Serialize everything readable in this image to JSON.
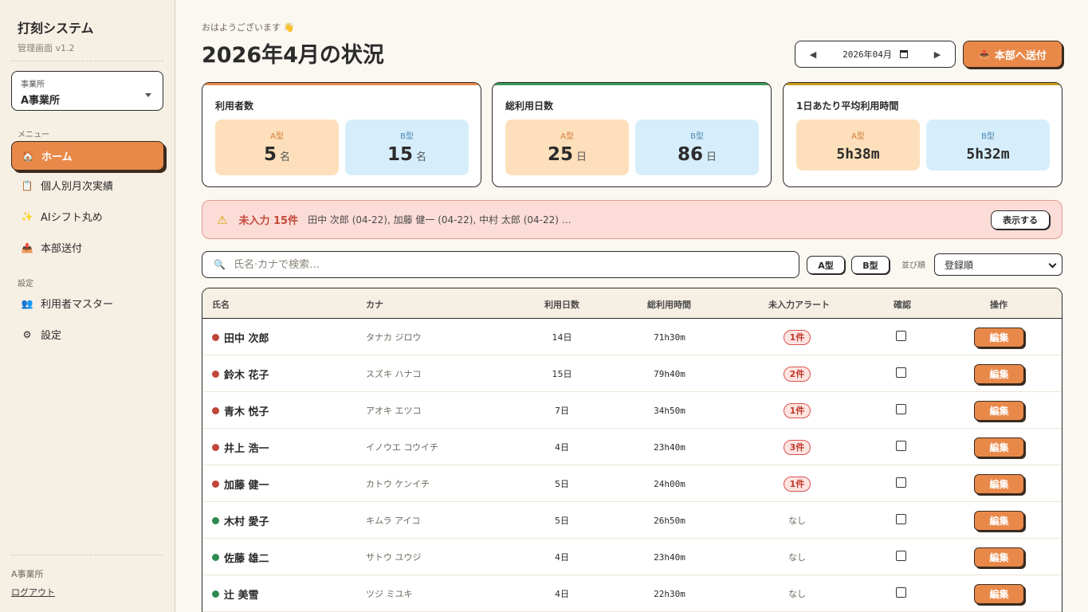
{
  "sidebar": {
    "title": "打刻システム",
    "version": "管理画面 v1.2",
    "office_label": "事業所",
    "office_value": "A事業所",
    "menu_label": "メニュー",
    "settings_label": "設定",
    "nav": [
      {
        "label": "ホーム",
        "icon": "🏠"
      },
      {
        "label": "個人別月次実績",
        "icon": "📋"
      },
      {
        "label": "AIシフト丸め",
        "icon": "✨"
      },
      {
        "label": "本部送付",
        "icon": "📤"
      }
    ],
    "settings_nav": [
      {
        "label": "利用者マスター",
        "icon": "👥"
      },
      {
        "label": "設定",
        "icon": "⚙"
      }
    ],
    "footer_office": "A事業所",
    "logout": "ログアウト"
  },
  "header": {
    "greeting": "おはようございます 👋",
    "title": "2026年4月の状況",
    "month_value": "2026年04月",
    "prev": "◀",
    "next": "▶",
    "send_label": "本部へ送付",
    "send_icon": "📤"
  },
  "stats": [
    {
      "title": "利用者数",
      "a_label": "A型",
      "a_value": "5",
      "a_unit": "名",
      "b_label": "B型",
      "b_value": "15",
      "b_unit": "名",
      "color": "#e8894a"
    },
    {
      "title": "総利用日数",
      "a_label": "A型",
      "a_value": "25",
      "a_unit": "日",
      "b_label": "B型",
      "b_value": "86",
      "b_unit": "日",
      "color": "#3a9a5a"
    },
    {
      "title": "1日あたり平均利用時間",
      "a_label": "A型",
      "a_value": "5h38m",
      "b_label": "B型",
      "b_value": "5h32m",
      "color": "#c89a1a"
    }
  ],
  "alert": {
    "icon": "⚠",
    "count": "未入力 15件",
    "names": "田中 次郎 (04-22), 加藤 健一 (04-22), 中村 太郎 (04-22) …",
    "button": "表示する"
  },
  "search": {
    "placeholder": "氏名·カナで検索…",
    "icon": "🔍"
  },
  "filters": {
    "a": "A型",
    "b": "B型",
    "sort_label": "並び順",
    "sort_value": "登録順"
  },
  "table": {
    "headers": [
      "氏名",
      "カナ",
      "利用日数",
      "総利用時間",
      "未入力アラート",
      "確認",
      "操作"
    ],
    "edit_label": "編集",
    "rows": [
      {
        "name": "田中 次郎",
        "kana": "タナカ ジロウ",
        "days": "14日",
        "time": "71h30m",
        "alert": "1件",
        "status": "red"
      },
      {
        "name": "鈴木 花子",
        "kana": "スズキ ハナコ",
        "days": "15日",
        "time": "79h40m",
        "alert": "2件",
        "status": "red"
      },
      {
        "name": "青木 悦子",
        "kana": "アオキ エツコ",
        "days": "7日",
        "time": "34h50m",
        "alert": "1件",
        "status": "red"
      },
      {
        "name": "井上 浩一",
        "kana": "イノウエ コウイチ",
        "days": "4日",
        "time": "23h40m",
        "alert": "3件",
        "status": "red"
      },
      {
        "name": "加藤 健一",
        "kana": "カトウ ケンイチ",
        "days": "5日",
        "time": "24h00m",
        "alert": "1件",
        "status": "red"
      },
      {
        "name": "木村 愛子",
        "kana": "キムラ アイコ",
        "days": "5日",
        "time": "26h50m",
        "alert": "なし",
        "status": "green"
      },
      {
        "name": "佐藤 雄二",
        "kana": "サトウ ユウジ",
        "days": "4日",
        "time": "23h40m",
        "alert": "なし",
        "status": "green"
      },
      {
        "name": "辻 美雪",
        "kana": "ツジ ミユキ",
        "days": "4日",
        "time": "22h30m",
        "alert": "なし",
        "status": "green"
      }
    ]
  },
  "colors": {
    "accent": "#e8894a",
    "red": "#c0463a",
    "green": "#2e8b4f"
  }
}
